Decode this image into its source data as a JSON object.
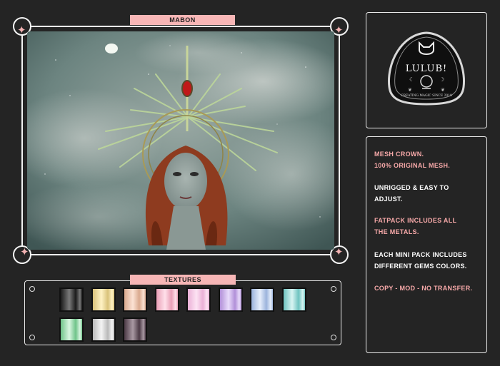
{
  "product": {
    "title": "MABON"
  },
  "textures": {
    "title": "TEXTURES",
    "swatches": [
      {
        "name": "black",
        "color": "#1b1b1b",
        "highlight": "#7a7a7a"
      },
      {
        "name": "gold",
        "color": "#d9c27a",
        "highlight": "#fff2c4"
      },
      {
        "name": "rose-gold",
        "color": "#d9a98e",
        "highlight": "#fbe2d4"
      },
      {
        "name": "pink",
        "color": "#e99fb6",
        "highlight": "#ffe0ea"
      },
      {
        "name": "light-pink",
        "color": "#eab0d6",
        "highlight": "#fde3f3"
      },
      {
        "name": "lavender",
        "color": "#b18fd8",
        "highlight": "#e9dcfb"
      },
      {
        "name": "blue",
        "color": "#9bb3dc",
        "highlight": "#e6eefb"
      },
      {
        "name": "teal",
        "color": "#6ec3c0",
        "highlight": "#d8f4f2"
      },
      {
        "name": "green",
        "color": "#6fc389",
        "highlight": "#d9f6e1"
      },
      {
        "name": "silver",
        "color": "#b9b9b9",
        "highlight": "#f4f4f4"
      },
      {
        "name": "mauve",
        "color": "#4a3944",
        "highlight": "#a999a3"
      }
    ]
  },
  "logo": {
    "brand": "LULUB!",
    "tagline": "CREATING MAGIC SINCE 2018"
  },
  "description": {
    "lines": [
      {
        "text": "MESH CROWN.",
        "color": "pink"
      },
      {
        "text": "100% ORIGINAL MESH.",
        "color": "pink"
      },
      {
        "text": "UNRIGGED & EASY TO",
        "color": "white"
      },
      {
        "text": "ADJUST.",
        "color": "white"
      },
      {
        "text": "FATPACK INCLUDES ALL",
        "color": "pink"
      },
      {
        "text": "THE METALS.",
        "color": "pink"
      },
      {
        "text": "EACH MINI PACK INCLUDES",
        "color": "white"
      },
      {
        "text": "DIFFERENT GEMS COLORS.",
        "color": "white"
      },
      {
        "text": "COPY - MOD - NO TRANSFER.",
        "color": "pink"
      }
    ]
  },
  "colors": {
    "accent": "#f7b6b6",
    "background": "#242424",
    "border": "#f2f2f2"
  }
}
